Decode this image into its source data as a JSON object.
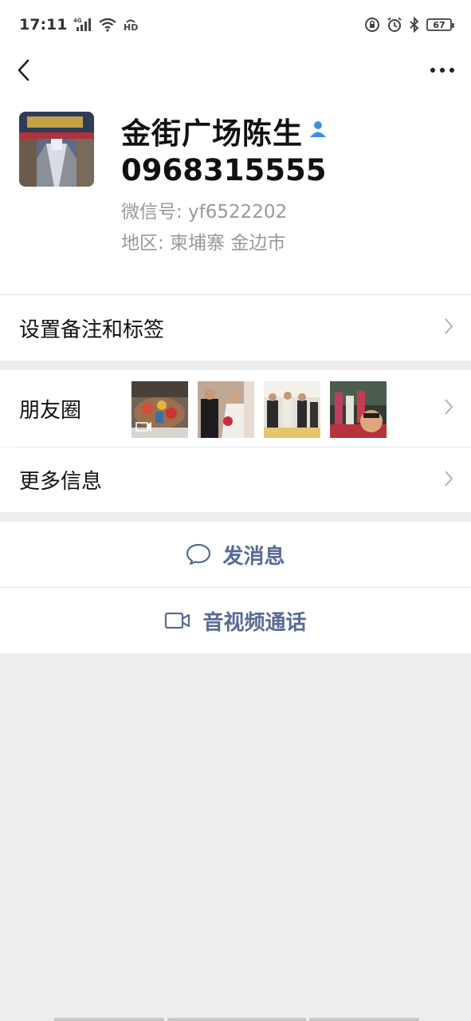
{
  "status_bar": {
    "time": "17:11",
    "network": "4G",
    "hd": "HD",
    "battery": "67"
  },
  "contact": {
    "name": "金街广场陈生",
    "phone": "0968315555",
    "wechat_id": "微信号: yf6522202",
    "region": "地区: 柬埔寨  金边市"
  },
  "menu": {
    "remark_tags": "设置备注和标签",
    "moments": "朋友圈",
    "more_info": "更多信息"
  },
  "actions": {
    "message": "发消息",
    "video_call": "音视频通话"
  },
  "icons": {
    "back": "back-arrow-icon",
    "more": "more-dots-icon",
    "badge": "verified-user-icon",
    "chevron": "chevron-right-icon",
    "message": "chat-bubble-icon",
    "video": "video-camera-icon"
  },
  "colors": {
    "accent": "#576b95",
    "badge": "#3e8ee8",
    "background": "#ededed"
  }
}
